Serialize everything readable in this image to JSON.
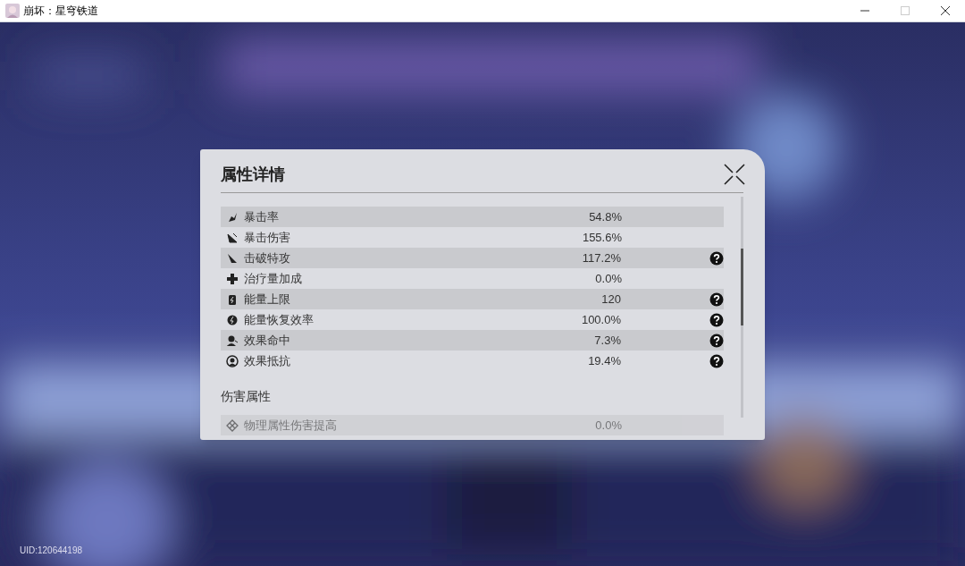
{
  "window": {
    "title": "崩坏：星穹铁道"
  },
  "dialog": {
    "title": "属性详情"
  },
  "sections": [
    {
      "rows": [
        {
          "label": "暴击率",
          "value": "54.8%",
          "help": false
        },
        {
          "label": "暴击伤害",
          "value": "155.6%",
          "help": false
        },
        {
          "label": "击破特攻",
          "value": "117.2%",
          "help": true
        },
        {
          "label": "治疗量加成",
          "value": "0.0%",
          "help": false
        },
        {
          "label": "能量上限",
          "value": "120",
          "help": true
        },
        {
          "label": "能量恢复效率",
          "value": "100.0%",
          "help": true
        },
        {
          "label": "效果命中",
          "value": "7.3%",
          "help": true
        },
        {
          "label": "效果抵抗",
          "value": "19.4%",
          "help": true
        }
      ]
    },
    {
      "title": "伤害属性",
      "rows": [
        {
          "label": "物理属性伤害提高",
          "value": "0.0%",
          "help": false
        }
      ]
    }
  ],
  "uid": "UID:120644198"
}
